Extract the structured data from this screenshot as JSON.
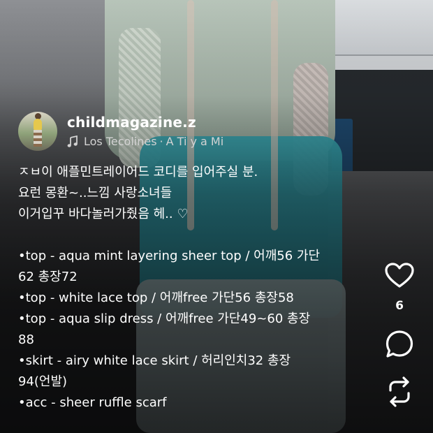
{
  "author": {
    "username": "childmagazine.z",
    "music": {
      "icon": "music-note-icon",
      "artist": "Los Tecolines",
      "separator": "·",
      "title": "A Ti y a Mi"
    }
  },
  "caption": {
    "intro_lines": [
      "ㅈㅂ이 애플민트레이어드 코디를 입어주실 분.",
      "요런 몽환~..느낌 사랑소녀들",
      "이거입꾸 바다놀러가줬음 헤.. ♡"
    ],
    "item_lines": [
      "•top - aqua mint layering sheer top / 어깨56 가단",
      "62 총장72",
      "•top - white lace top / 어깨free 가단56 총장58",
      "•top - aqua slip dress / 어깨free 가단49~60 총장",
      "88",
      "•skirt - airy white lace skirt / 허리인치32 총장",
      "94(언발)",
      "•acc - sheer ruffle scarf"
    ]
  },
  "actions": {
    "like": {
      "icon": "heart-icon",
      "count": "6"
    },
    "comment": {
      "icon": "comment-icon"
    },
    "repost": {
      "icon": "repost-icon"
    }
  },
  "colors": {
    "text": "#ffffff",
    "secondary_text": "#d3d3d3"
  }
}
